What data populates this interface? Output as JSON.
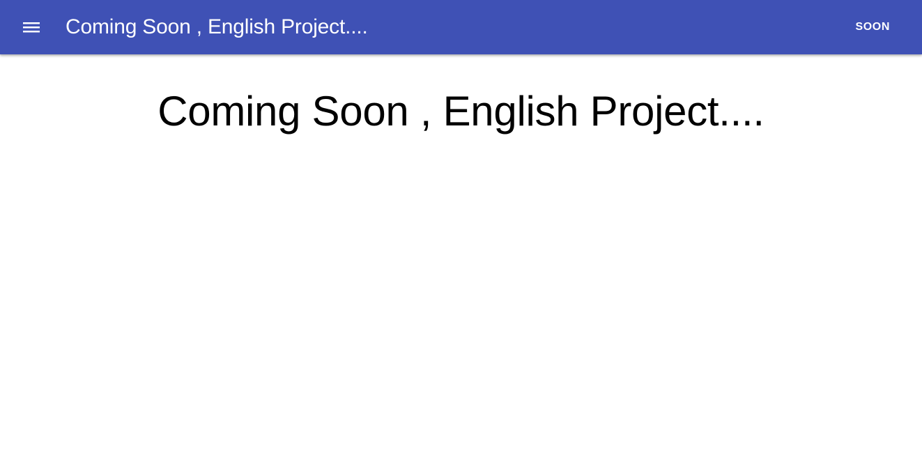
{
  "app_bar": {
    "menu_icon": "menu-icon",
    "title": "Coming Soon , English Project....",
    "action_label": "SOON",
    "background_color": "#3f51b5",
    "text_color": "#ffffff"
  },
  "main": {
    "heading": "Coming Soon , English Project....",
    "text_color": "#000000",
    "background_color": "#ffffff"
  }
}
